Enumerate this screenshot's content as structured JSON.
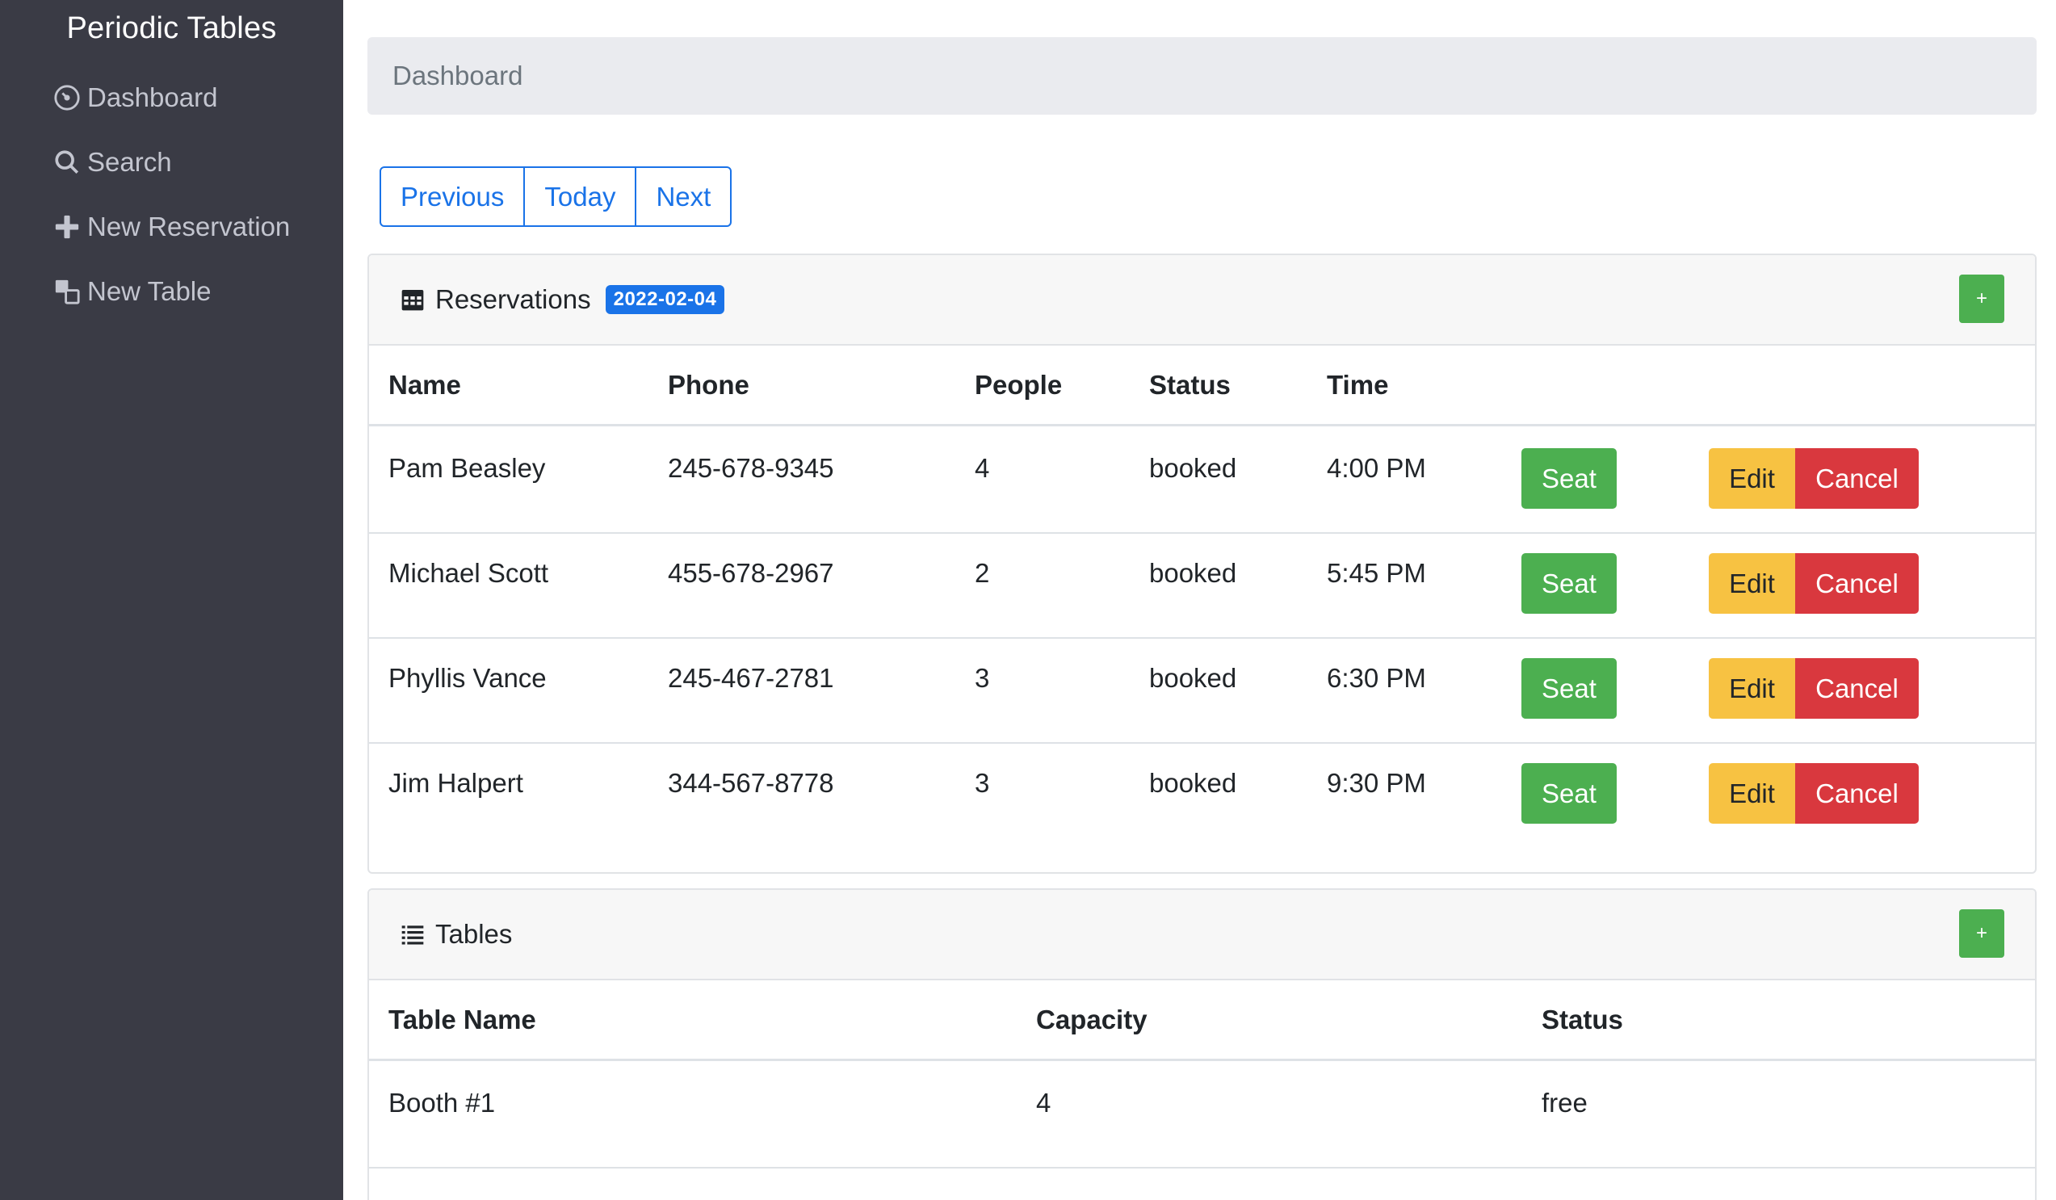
{
  "sidebar": {
    "brand": "Periodic Tables",
    "items": [
      {
        "label": "Dashboard",
        "icon": "dashboard-icon"
      },
      {
        "label": "Search",
        "icon": "search-icon"
      },
      {
        "label": "New Reservation",
        "icon": "plus-icon"
      },
      {
        "label": "New Table",
        "icon": "table-icon"
      }
    ]
  },
  "breadcrumb": "Dashboard",
  "date_nav": {
    "previous": "Previous",
    "today": "Today",
    "next": "Next"
  },
  "reservations": {
    "title": "Reservations",
    "date_badge": "2022-02-04",
    "add_label": "+",
    "columns": [
      "Name",
      "Phone",
      "People",
      "Status",
      "Time"
    ],
    "rows": [
      {
        "name": "Pam Beasley",
        "phone": "245-678-9345",
        "people": "4",
        "status": "booked",
        "time": "4:00 PM"
      },
      {
        "name": "Michael Scott",
        "phone": "455-678-2967",
        "people": "2",
        "status": "booked",
        "time": "5:45 PM"
      },
      {
        "name": "Phyllis Vance",
        "phone": "245-467-2781",
        "people": "3",
        "status": "booked",
        "time": "6:30 PM"
      },
      {
        "name": "Jim Halpert",
        "phone": "344-567-8778",
        "people": "3",
        "status": "booked",
        "time": "9:30 PM"
      }
    ],
    "actions": {
      "seat": "Seat",
      "edit": "Edit",
      "cancel": "Cancel"
    }
  },
  "tables": {
    "title": "Tables",
    "add_label": "+",
    "columns": [
      "Table Name",
      "Capacity",
      "Status"
    ],
    "rows": [
      {
        "name": "Booth #1",
        "capacity": "4",
        "status": "free"
      }
    ]
  },
  "colors": {
    "sidebar_bg": "#3a3b45",
    "primary": "#1a73e8",
    "success": "#4caf50",
    "warning": "#f7c242",
    "danger": "#d9383e"
  }
}
